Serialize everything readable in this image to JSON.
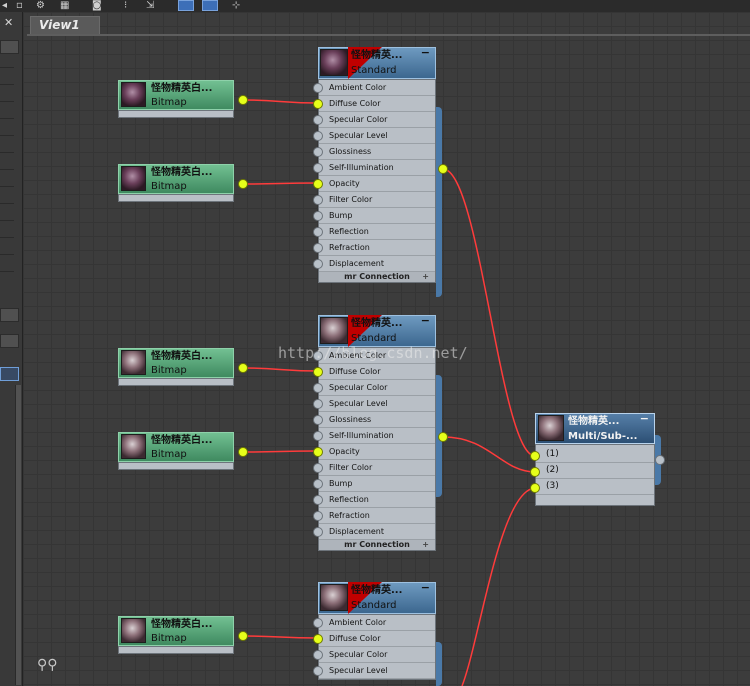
{
  "viewport": {
    "tab": "View1"
  },
  "watermark": "http://blog.csdn.net/",
  "std_slots": [
    "Ambient Color",
    "Diffuse Color",
    "Specular Color",
    "Specular Level",
    "Glossiness",
    "Self-Illumination",
    "Opacity",
    "Filter Color",
    "Bump",
    "Reflection",
    "Refraction",
    "Displacement"
  ],
  "std_slots_partial": [
    "Ambient Color",
    "Diffuse Color",
    "Specular Color",
    "Specular Level"
  ],
  "mr_connection": "mr Connection",
  "bitmap_nodes": [
    {
      "title": "怪物精英白...",
      "type": "Bitmap"
    },
    {
      "title": "怪物精英白...",
      "type": "Bitmap"
    },
    {
      "title": "怪物精英白...",
      "type": "Bitmap"
    },
    {
      "title": "怪物精英白...",
      "type": "Bitmap"
    },
    {
      "title": "怪物精英白...",
      "type": "Bitmap"
    }
  ],
  "standard_nodes": [
    {
      "title": "怪物精英...",
      "type": "Standard"
    },
    {
      "title": "怪物精英...",
      "type": "Standard"
    },
    {
      "title": "怪物精英...",
      "type": "Standard"
    }
  ],
  "multi_node": {
    "title": "怪物精英...",
    "type": "Multi/Sub-...",
    "slots": [
      "(1)",
      "(2)",
      "(3)"
    ]
  },
  "colors": {
    "wire": "#ff3b3b",
    "socket": "#e6ff1a",
    "bitmap_node": "#5aa77a",
    "material_node": "#4f7ca6"
  },
  "icons": [
    "close-icon",
    "binoculars-icon"
  ]
}
